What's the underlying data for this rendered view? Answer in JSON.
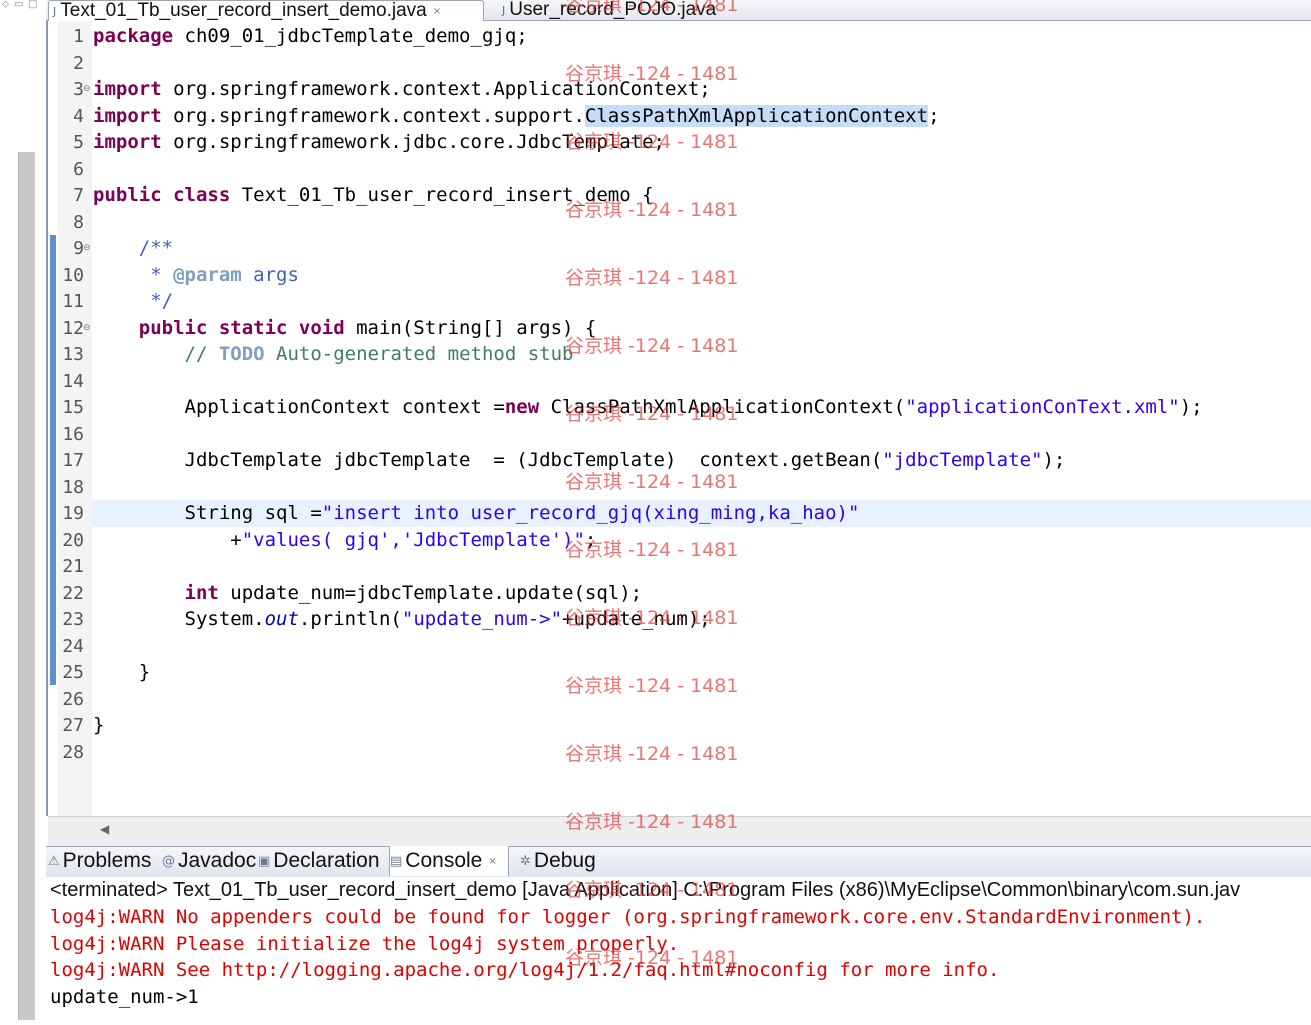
{
  "tabs": {
    "editor": [
      {
        "label": "Text_01_Tb_user_record_insert_demo.java",
        "icon": "java-file-icon",
        "active": true
      },
      {
        "label": "User_record_POJO.java",
        "icon": "java-file-icon",
        "active": false
      }
    ],
    "close_glyph": "×"
  },
  "editor": {
    "lines": [
      {
        "n": "1"
      },
      {
        "n": "2"
      },
      {
        "n": "3"
      },
      {
        "n": "4"
      },
      {
        "n": "5"
      },
      {
        "n": "6"
      },
      {
        "n": "7"
      },
      {
        "n": "8"
      },
      {
        "n": "9"
      },
      {
        "n": "10"
      },
      {
        "n": "11"
      },
      {
        "n": "12"
      },
      {
        "n": "13"
      },
      {
        "n": "14"
      },
      {
        "n": "15"
      },
      {
        "n": "16"
      },
      {
        "n": "17"
      },
      {
        "n": "18"
      },
      {
        "n": "19"
      },
      {
        "n": "20"
      },
      {
        "n": "21"
      },
      {
        "n": "22"
      },
      {
        "n": "23"
      },
      {
        "n": "24"
      },
      {
        "n": "25"
      },
      {
        "n": "26"
      },
      {
        "n": "27"
      },
      {
        "n": "28"
      }
    ],
    "code": {
      "l1_kw": "package",
      "l1_rest": " ch09_01_jdbcTemplate_demo_",
      "l1_tag": "gjq",
      "l1_end": ";",
      "l3_kw": "import",
      "l3_rest": " org.springframework.context.ApplicationContext;",
      "l4_kw": "import",
      "l4_rest": " org.springframework.context.support.",
      "l4_sel": "ClassPathXmlApplicationContext",
      "l4_end": ";",
      "l5_kw": "import",
      "l5_rest": " org.springframework.jdbc.core.JdbcTemplate;",
      "l7_kw": "public class",
      "l7_rest": " Text_01_Tb_user_record_insert_demo {",
      "l9": "    /**",
      "l10_a": "     * ",
      "l10_tag": "@param",
      "l10_b": " args",
      "l11": "     */",
      "l12_kw": "    public static void",
      "l12_rest": " main(String[] args) {",
      "l13_a": "        // ",
      "l13_todo": "TODO",
      "l13_b": " Auto-generated method stub",
      "l15_a": "        ApplicationContext context =",
      "l15_kw": "new",
      "l15_b": " ClassPathXmlApplicationContext(",
      "l15_str": "\"applicationConText.xml\"",
      "l15_end": ");",
      "l17_a": "        JdbcTemplate jdbcTemplate  = (JdbcTemplate)  context.getBean(",
      "l17_str": "\"jdbcTemplate\"",
      "l17_end": ");",
      "l19_a": "        String sql =",
      "l19_str": "\"insert into user_record_gjq(xing_ming,ka_hao)\"",
      "l20_a": "            +",
      "l20_str": "\"values( gjq','JdbcTemplate')\"",
      "l20_end": ";",
      "l22_kw": "        int",
      "l22_rest": " update_num=jdbcTemplate.update(sql);",
      "l23_a": "        System.",
      "l23_fld": "out",
      "l23_b": ".println(",
      "l23_str": "\"update_num->\"",
      "l23_end": "+update_num);",
      "l25": "    }",
      "l27": "}"
    }
  },
  "console_tabs": [
    {
      "label": "Problems",
      "icon": "problems-icon"
    },
    {
      "label": "Javadoc",
      "icon": "javadoc-icon"
    },
    {
      "label": "Declaration",
      "icon": "declaration-icon"
    },
    {
      "label": "Console",
      "icon": "console-icon"
    },
    {
      "label": "Debug",
      "icon": "debug-icon"
    }
  ],
  "console": {
    "status": "<terminated> Text_01_Tb_user_record_insert_demo [Java Application] C:\\Program Files (x86)\\MyEclipse\\Common\\binary\\com.sun.jav",
    "lines": [
      {
        "text": "log4j:WARN No appenders could be found for logger (org.springframework.core.env.StandardEnvironment).",
        "color": "#e00000"
      },
      {
        "text": "log4j:WARN Please initialize the log4j system properly.",
        "color": "#e00000"
      },
      {
        "text": "log4j:WARN See http://logging.apache.org/log4j/1.2/faq.html#noconfig for more info.",
        "color": "#e00000"
      },
      {
        "text": "update_num->1",
        "color": "#000000"
      }
    ]
  },
  "watermark": "谷京琪 -124 - 1481",
  "colors": {
    "keyword": "#7f0055",
    "string": "#2a00ff",
    "javadoc": "#3f5fbf",
    "comment": "#3f7f5f",
    "error": "#e00000",
    "selection": "#c6dcf7"
  }
}
